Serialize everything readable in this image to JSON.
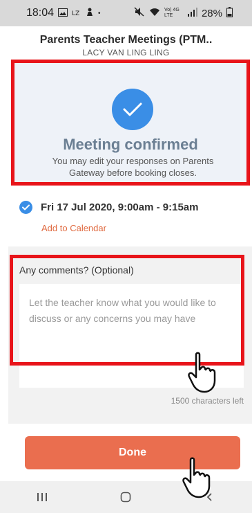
{
  "status_bar": {
    "time": "18:04",
    "left_icons": [
      "gallery-icon",
      "lazada-icon",
      "notification-icon",
      "dot-icon"
    ],
    "right_icons": [
      "mute-icon",
      "wifi-icon",
      "lte-icon",
      "signal-icon"
    ],
    "network": "Vo) 4G LTE",
    "battery_percent": "28%"
  },
  "header": {
    "title": "Parents Teacher Meetings (PTM..",
    "subtitle": "LACY VAN LING LING"
  },
  "confirmation": {
    "title": "Meeting confirmed",
    "description": "You may edit your responses on Parents Gateway before booking closes.",
    "accent": "#3a8ee6"
  },
  "booking": {
    "slot": "Fri 17 Jul 2020, 9:00am - 9:15am",
    "add_to_calendar": "Add to Calendar"
  },
  "comments": {
    "label": "Any comments? (Optional)",
    "placeholder": "Let the teacher know what you would like to discuss or any concerns you may have",
    "value": "",
    "chars_left": "1500 characters left"
  },
  "actions": {
    "done_label": "Done",
    "done_color": "#ea6e4f"
  },
  "highlight_color": "#e8141a",
  "nav": [
    "recent-apps-icon",
    "home-icon",
    "back-icon"
  ]
}
